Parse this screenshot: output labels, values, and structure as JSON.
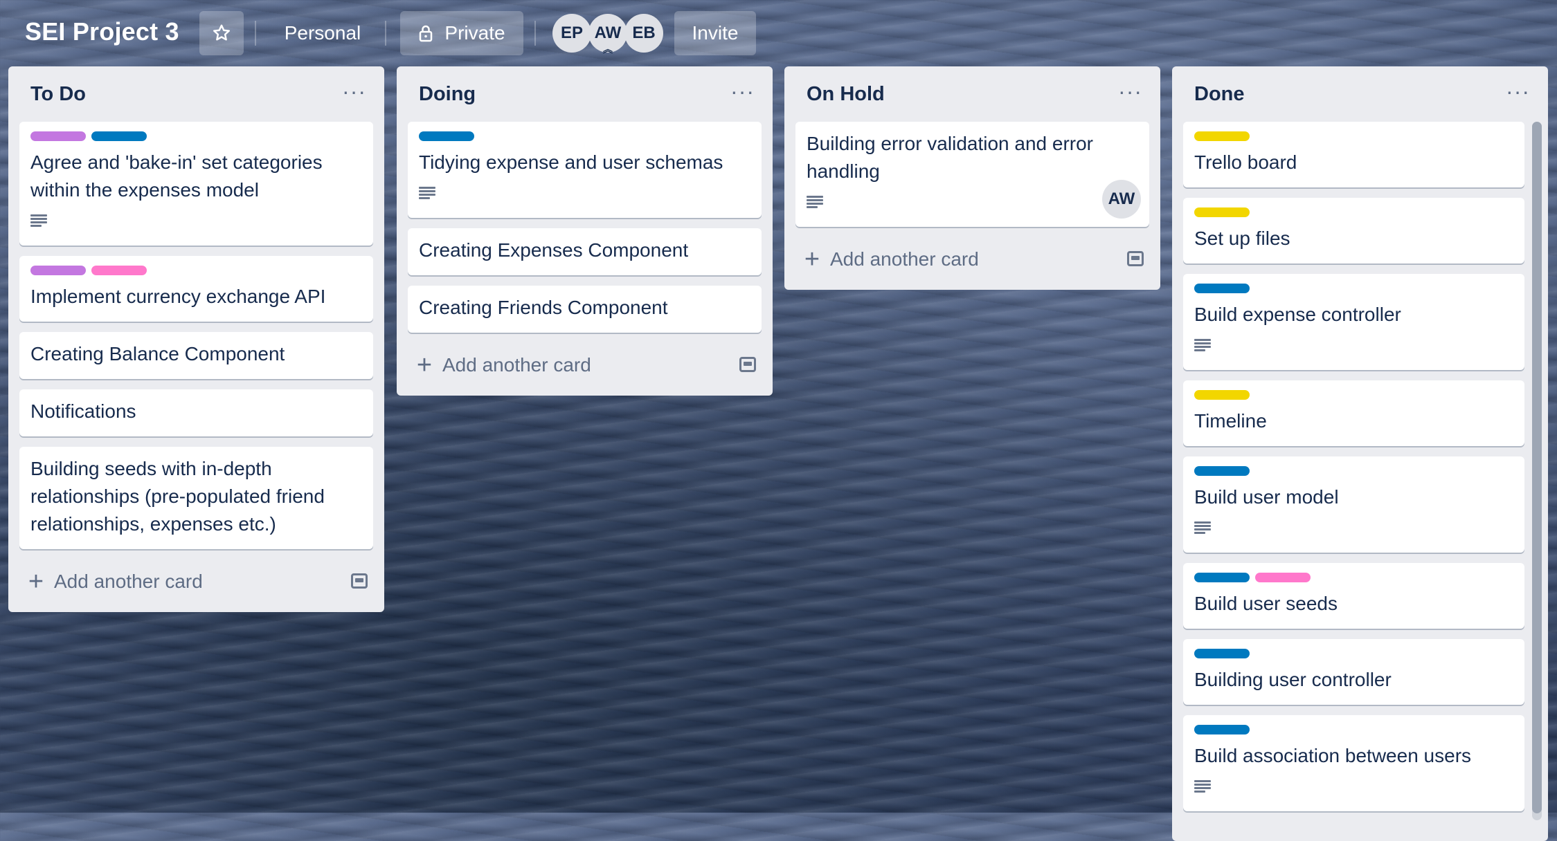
{
  "board": {
    "title": "SEI Project 3",
    "team": "Personal",
    "visibility": "Private",
    "invite_label": "Invite",
    "members": [
      "EP",
      "AW",
      "EB"
    ]
  },
  "colors": {
    "purple": "#c377e0",
    "blue": "#0079bf",
    "pink": "#ff78cb",
    "yellow": "#f2d600"
  },
  "lists": [
    {
      "name": "To Do",
      "menu": "···",
      "add_label": "Add another card",
      "cards": [
        {
          "title": "Agree and 'bake-in' set categories within the expenses model",
          "labels": [
            "purple",
            "blue"
          ],
          "has_description": true
        },
        {
          "title": "Implement currency exchange API",
          "labels": [
            "purple",
            "pink"
          ],
          "has_description": false
        },
        {
          "title": "Creating Balance Component",
          "labels": [],
          "has_description": false
        },
        {
          "title": "Notifications",
          "labels": [],
          "has_description": false
        },
        {
          "title": "Building seeds with in-depth relationships (pre-populated friend relationships, expenses etc.)",
          "labels": [],
          "has_description": false
        }
      ]
    },
    {
      "name": "Doing",
      "menu": "···",
      "add_label": "Add another card",
      "cards": [
        {
          "title": "Tidying expense and user schemas",
          "labels": [
            "blue"
          ],
          "has_description": true
        },
        {
          "title": "Creating Expenses Component",
          "labels": [],
          "has_description": false
        },
        {
          "title": "Creating Friends Component",
          "labels": [],
          "has_description": false
        }
      ]
    },
    {
      "name": "On Hold",
      "menu": "···",
      "add_label": "Add another card",
      "cards": [
        {
          "title": "Building error validation and error handling",
          "labels": [],
          "has_description": true,
          "member": "AW"
        }
      ]
    },
    {
      "name": "Done",
      "menu": "···",
      "add_label": "",
      "cards": [
        {
          "title": "Trello board",
          "labels": [
            "yellow"
          ],
          "has_description": false
        },
        {
          "title": "Set up files",
          "labels": [
            "yellow"
          ],
          "has_description": false
        },
        {
          "title": "Build expense controller",
          "labels": [
            "blue"
          ],
          "has_description": true
        },
        {
          "title": "Timeline",
          "labels": [
            "yellow"
          ],
          "has_description": false
        },
        {
          "title": "Build user model",
          "labels": [
            "blue"
          ],
          "has_description": true
        },
        {
          "title": "Build user seeds",
          "labels": [
            "blue",
            "pink"
          ],
          "has_description": false
        },
        {
          "title": "Building user controller",
          "labels": [
            "blue"
          ],
          "has_description": false
        },
        {
          "title": "Build association between users",
          "labels": [
            "blue"
          ],
          "has_description": true
        }
      ]
    }
  ]
}
